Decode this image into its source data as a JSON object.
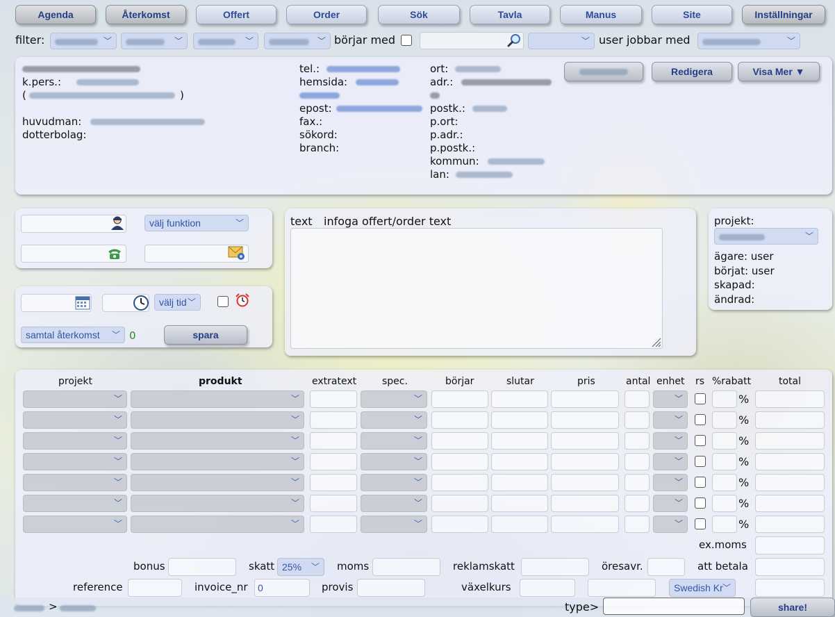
{
  "nav": [
    {
      "label": "Agenda",
      "style": "gray"
    },
    {
      "label": "Återkomst",
      "style": "gray"
    },
    {
      "label": "Offert",
      "style": "blue"
    },
    {
      "label": "Order",
      "style": "blue"
    },
    {
      "label": "Sök",
      "style": "blue"
    },
    {
      "label": "Tavla",
      "style": "blue"
    },
    {
      "label": "Manus",
      "style": "blue"
    },
    {
      "label": "Site",
      "style": "blue"
    },
    {
      "label": "Inställningar",
      "style": "gray"
    }
  ],
  "filter": {
    "label": "filter:",
    "borjar_med": "börjar med",
    "user_jobbar_med": "user jobbar med"
  },
  "contact": {
    "kpers": "k.pers.:",
    "paren_open": "(",
    "paren_close": ")",
    "huvudman": "huvudman:",
    "dotterbolag": "dotterbolag:",
    "tel": "tel.:",
    "hemsida": "hemsida:",
    "epost": "epost:",
    "fax": "fax.:",
    "sokord": "sökord:",
    "branch": "branch:",
    "ort": "ort:",
    "adr": "adr.:",
    "postk": "postk.:",
    "port": "p.ort:",
    "padr": "p.adr.:",
    "ppostk": "p.postk.:",
    "kommun": "kommun:",
    "lan": "lan:",
    "redigera": "Redigera",
    "visa_mer": "Visa Mer ▼"
  },
  "activity": {
    "valj_funktion": "välj funktion",
    "valj_tid": "välj tid",
    "samtal_aterkomst": "samtal återkomst",
    "counter": "0",
    "spara": "spara"
  },
  "text_panel": {
    "text_label": "text",
    "infoga": "infoga offert/order text"
  },
  "project_panel": {
    "projekt": "projekt:",
    "agare": "ägare: user",
    "borjat": "börjat: user",
    "skapad": "skapad:",
    "andrad": "ändrad:"
  },
  "table": {
    "headers": {
      "projekt": "projekt",
      "produkt": "produkt",
      "extratext": "extratext",
      "spec": "spec.",
      "borjar": "börjar",
      "slutar": "slutar",
      "pris": "pris",
      "antal": "antal",
      "enhet": "enhet",
      "rs": "rs",
      "rabatt": "%rabatt",
      "total": "total"
    },
    "percent": "%"
  },
  "totals": {
    "exmoms": "ex.moms",
    "bonus": "bonus",
    "skatt": "skatt",
    "skatt_value": "25%",
    "moms": "moms",
    "reklamskatt": "reklamskatt",
    "oresavr": "öresavr.",
    "att_betala": "att betala",
    "reference": "reference",
    "invoice_nr": "invoice_nr",
    "invoice_value": "0",
    "provis": "provis",
    "vaxelkurs": "växelkurs",
    "currency": "Swedish Kr"
  },
  "bottom": {
    "arrow": ">",
    "type_label": "type>",
    "share": "share!"
  },
  "colors": {
    "accent": "#2b4b9a",
    "link": "#2f56a8",
    "panel": "#eef0ff"
  }
}
